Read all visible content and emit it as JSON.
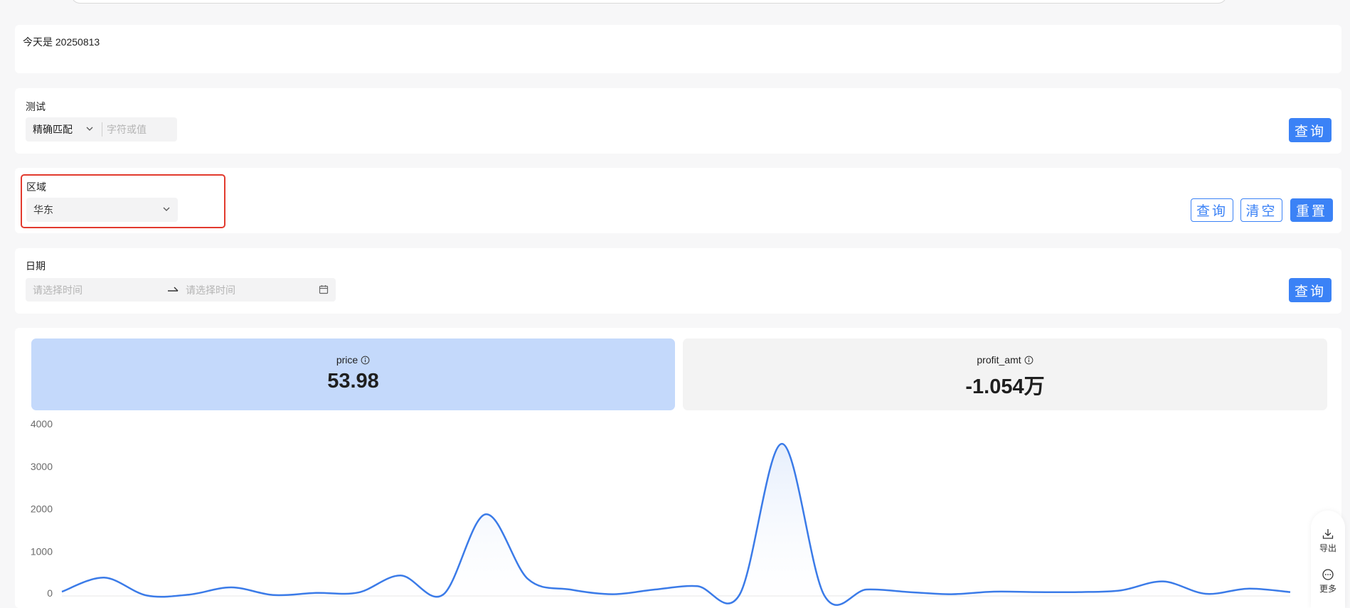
{
  "header": {
    "today": "今天是 20250813"
  },
  "test_filter": {
    "label": "测试",
    "match_mode": "精确匹配",
    "input_placeholder": "字符或值",
    "query_label": "查询"
  },
  "region_filter": {
    "label": "区域",
    "selected": "华东",
    "query_label": "查询",
    "clear_label": "清空",
    "reset_label": "重置"
  },
  "date_filter": {
    "label": "日期",
    "start_placeholder": "请选择时间",
    "end_placeholder": "请选择时间",
    "query_label": "查询"
  },
  "kpis": [
    {
      "name": "price",
      "value": "53.98",
      "highlight": true
    },
    {
      "name": "profit_amt",
      "value": "-1.054万",
      "highlight": false
    }
  ],
  "float_menu": {
    "export_label": "导出",
    "more_label": "更多"
  },
  "colors": {
    "primary": "#3b82f6",
    "kpi_active": "#c4d9fb",
    "kpi_inactive": "#f3f3f3",
    "highlight_border": "#e23a2e",
    "line": "#3b7be8"
  },
  "chart_data": {
    "type": "line",
    "smooth": true,
    "area_fill": true,
    "grid": false,
    "ylim": [
      0,
      4000
    ],
    "yticks": [
      "4000",
      "3000",
      "2000",
      "1000",
      "0"
    ],
    "values": [
      50,
      380,
      -40,
      -20,
      150,
      -30,
      20,
      30,
      430,
      -20,
      1870,
      350,
      100,
      -10,
      100,
      180,
      -20,
      3530,
      -40,
      100,
      40,
      -10,
      50,
      40,
      40,
      80,
      290,
      0,
      120,
      40
    ]
  }
}
